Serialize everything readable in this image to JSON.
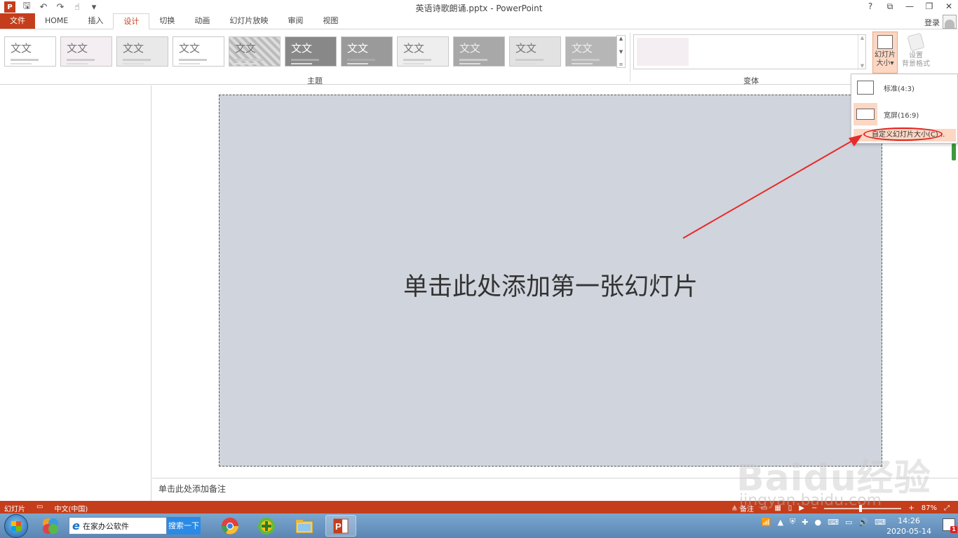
{
  "window": {
    "title": "英语诗歌朗诵.pptx - PowerPoint",
    "controls": [
      "?",
      "⧉",
      "—",
      "❐",
      "✕"
    ]
  },
  "quick_access": [
    "save-icon",
    "undo-icon",
    "redo-icon",
    "touch-mode-icon",
    "customize-icon"
  ],
  "tabs": [
    {
      "label": "文件"
    },
    {
      "label": "HOME"
    },
    {
      "label": "插入"
    },
    {
      "label": "设计"
    },
    {
      "label": "切换"
    },
    {
      "label": "动画"
    },
    {
      "label": "幻灯片放映"
    },
    {
      "label": "审阅"
    },
    {
      "label": "视图"
    }
  ],
  "active_tab": "设计",
  "account": {
    "login": "登录"
  },
  "ribbon": {
    "themes_group_label": "主题",
    "variants_group_label": "变体",
    "theme_thumb_text": "文文",
    "themes": [
      {
        "text": "文文"
      },
      {
        "text": "文文"
      },
      {
        "text": "文文"
      },
      {
        "text": "文文"
      },
      {
        "text": "文文"
      },
      {
        "text": "文文"
      },
      {
        "text": "文文"
      },
      {
        "text": "文文"
      },
      {
        "text": "文文"
      },
      {
        "text": "文文"
      },
      {
        "text": "文文"
      }
    ],
    "slide_size_button": {
      "line1": "幻灯片",
      "line2": "大小▾"
    },
    "format_bg_button": {
      "line1": "设置",
      "line2": "背景格式"
    }
  },
  "dropdown": {
    "items": [
      {
        "label": "标准(4:3)"
      },
      {
        "label": "宽屏(16:9)"
      },
      {
        "label": "自定义幻灯片大小(C)..."
      }
    ]
  },
  "slide": {
    "placeholder": "单击此处添加第一张幻灯片"
  },
  "notes": {
    "placeholder": "单击此处添加备注"
  },
  "status": {
    "left": [
      "幻灯片",
      "中文(中国)"
    ],
    "notes_label": "备注",
    "zoom": "87%"
  },
  "taskbar": {
    "ie_text": "在家办公软件",
    "search_button": "搜索一下",
    "time": "14:26",
    "date": "2020-05-14",
    "notification_count": "1"
  },
  "watermark": {
    "main": "Baidu经验",
    "sub": "jingyan.baidu.com"
  },
  "colors": {
    "accent": "#c43e1c",
    "highlight": "#fbd7c4",
    "slide_bg": "#d0d4dc"
  }
}
